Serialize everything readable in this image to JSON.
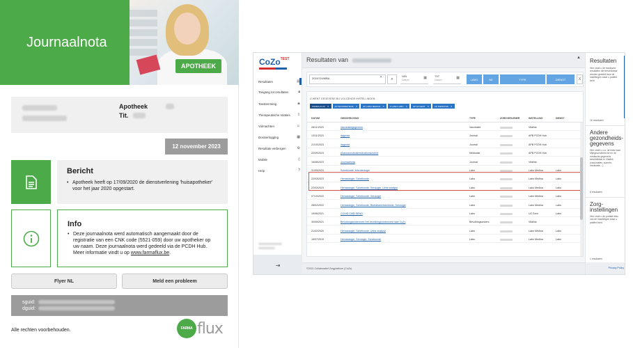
{
  "journaalnota": {
    "title": "Journaalnota",
    "badge": "APOTHEEK",
    "pharmacy_label": "Apotheek",
    "tit_label": "Tit.",
    "date": "12 november 2023",
    "bericht": {
      "title": "Bericht",
      "text": "Apotheek heeft op 17/09/2020 de dienstverlening 'huisapotheker' voor het jaar 2020 opgestart."
    },
    "info": {
      "title": "Info",
      "text": "Deze journaalnota werd automatisch aangemaakt door de registratie van een CNK code (5521-059) door uw apotheker op uw naam. Deze journaalnota werd gedeeld via de PCDH Hub. Meer informatie vindt u op",
      "link": "www.farmaflux.be",
      "link_suffix": "."
    },
    "buttons": {
      "flyer": "Flyer NL",
      "meld": "Meld een probleem"
    },
    "sguid_label": "sguid:",
    "dguid_label": "dguid:",
    "rights": "Alle rechten voorbehouden.",
    "logo": {
      "circle": "FARMA",
      "word": "flux"
    }
  },
  "cozo": {
    "logo": "CoZo",
    "logo_sup": "TEST",
    "sidebar": [
      {
        "label": "Resultaten",
        "icon": "doc-icon"
      },
      {
        "label": "Toegang tot resultaten",
        "icon": "lock-icon"
      },
      {
        "label": "Toestemming",
        "icon": "shield-icon"
      },
      {
        "label": "Therapeutische relaties",
        "icon": "upload-icon"
      },
      {
        "label": "Volmachten",
        "icon": "users-icon"
      },
      {
        "label": "Dossierlogging",
        "icon": "grid-icon"
      },
      {
        "label": "Resultate verbergen",
        "icon": "gear-icon"
      },
      {
        "label": "Mobile",
        "icon": "mobile-icon"
      },
      {
        "label": "Help",
        "icon": "question-icon"
      }
    ],
    "header_title": "Resultaten van",
    "search_value": "2024?24/MBA",
    "van_label": "VAN",
    "van_placeholder": "Datum",
    "tot_label": "TOT",
    "tot_placeholder": "Datum",
    "tabs": {
      "labo": "LABO",
      "ne": "NE",
      "type": "TYPE",
      "dienst": "DIENST"
    },
    "close": "X",
    "list_note": "U WENT GEGEVENS BIJ VOLGENDE INSTELLINGEN",
    "chips": [
      "FARMA-FLUX",
      "AP INFORMATIEVE",
      "AP LABO MEDINA",
      "Z LABO LABO",
      "AP AZ GENT",
      "AP DIENSTEN"
    ],
    "columns": {
      "datum": "DATUM",
      "omschrijving": "OMSCHRIJVING",
      "type": "TYPE",
      "zorgverlener": "ZORGVERLENER",
      "instelling": "INSTELLING",
      "dienst": "DIENST"
    },
    "rows": [
      {
        "datum": "28/11/2023",
        "omschrijving": "Vaccinatiegegevens",
        "type": "Vaccinatie",
        "instelling": "Vitalink",
        "dienst": ""
      },
      {
        "datum": "13/11/2023",
        "omschrijving": "dagnota",
        "type": "Journal",
        "instelling": "APB PCDH Hub",
        "dienst": ""
      },
      {
        "datum": "21/10/2023",
        "omschrijving": "dagnota",
        "type": "Journal",
        "instelling": "APB PCDH Hub",
        "dienst": ""
      },
      {
        "datum": "22/09/2023",
        "omschrijving": "pharmaceuticalmedicationscheme",
        "type": "Medicatie",
        "instelling": "APB PCDH Hub",
        "dienst": ""
      },
      {
        "datum": "16/06/2023",
        "omschrijving": "Journaalnota",
        "type": "Journal",
        "instelling": "Vitalink",
        "dienst": ""
      },
      {
        "datum": "31/05/2024",
        "omschrijving": "Scheikunde, Microbiologie",
        "type": "Labo",
        "instelling": "Labo Medina",
        "dienst": "Labo"
      },
      {
        "datum": "22/03/2023",
        "omschrijving": "Hematologie, Scheikunde",
        "type": "Labo",
        "instelling": "Labo Medina",
        "dienst": "Labo"
      },
      {
        "datum": "22/03/2023",
        "omschrijving": "Hematologie, Scheikunde, Serologie, Urine analyse",
        "type": "Labo",
        "instelling": "Labo Medina",
        "dienst": "Labo"
      },
      {
        "datum": "07/10/2022",
        "omschrijving": "Hematologie, Scheikunde, Serologie",
        "type": "Labo",
        "instelling": "Labo Medina",
        "dienst": "Labo"
      },
      {
        "datum": "28/02/2022",
        "omschrijving": "Hematologie, Scheikunde, Bloedbank/transfusie, Serologie",
        "type": "Labo",
        "instelling": "Labo Medina",
        "dienst": "Labo"
      },
      {
        "datum": "19/06/2021",
        "omschrijving": "COVID CMD SENO",
        "type": "Labo",
        "instelling": "UZ Gent",
        "dienst": "Labo"
      },
      {
        "datum": "30/05/2021",
        "omschrijving": "Bevolkingsonderzoek Het bevolkingsonderzoek naar CoZo",
        "type": "Bevolkingsonderz.",
        "instelling": "Vitalink",
        "dienst": ""
      },
      {
        "datum": "21/02/2020",
        "omschrijving": "Hematologie, Scheikunde, Urine analyse",
        "type": "Labo",
        "instelling": "Labo Medina",
        "dienst": "Labo"
      },
      {
        "datum": "16/07/2019",
        "omschrijving": "Hematologie, Serologie, Scheikunde",
        "type": "Labo",
        "instelling": "Labo Medina",
        "dienst": "Labo"
      }
    ],
    "footer": "©2021 Collaboratief Zorgplatform (CoZo)",
    "right_panel": {
      "resultaten_title": "Resultaten",
      "resultaten_text": "Hier vindt u de medische resultaten die beschikbaar worden gesteld door de instellingen waar u patiënt bent",
      "resultaten_count": "16 resultaten",
      "gezondheid_title": "Andere gezondheids-gegevens",
      "gezondheid_text": "Hier vindt u o.a. de links naar Mijngezondheid.be en de medische gegevens beschikbaar in Vitalink (vaccinaties, sumehr, medicatie,...)",
      "gezondheid_count": "8 resultaten",
      "zorg_title": "Zorg-instellingen",
      "zorg_text": "Hier vindt u de portaal links van de instellingen waar u patiënt bent",
      "zorg_count": "1 resultaten",
      "privacy": "Privacy Policy"
    }
  }
}
